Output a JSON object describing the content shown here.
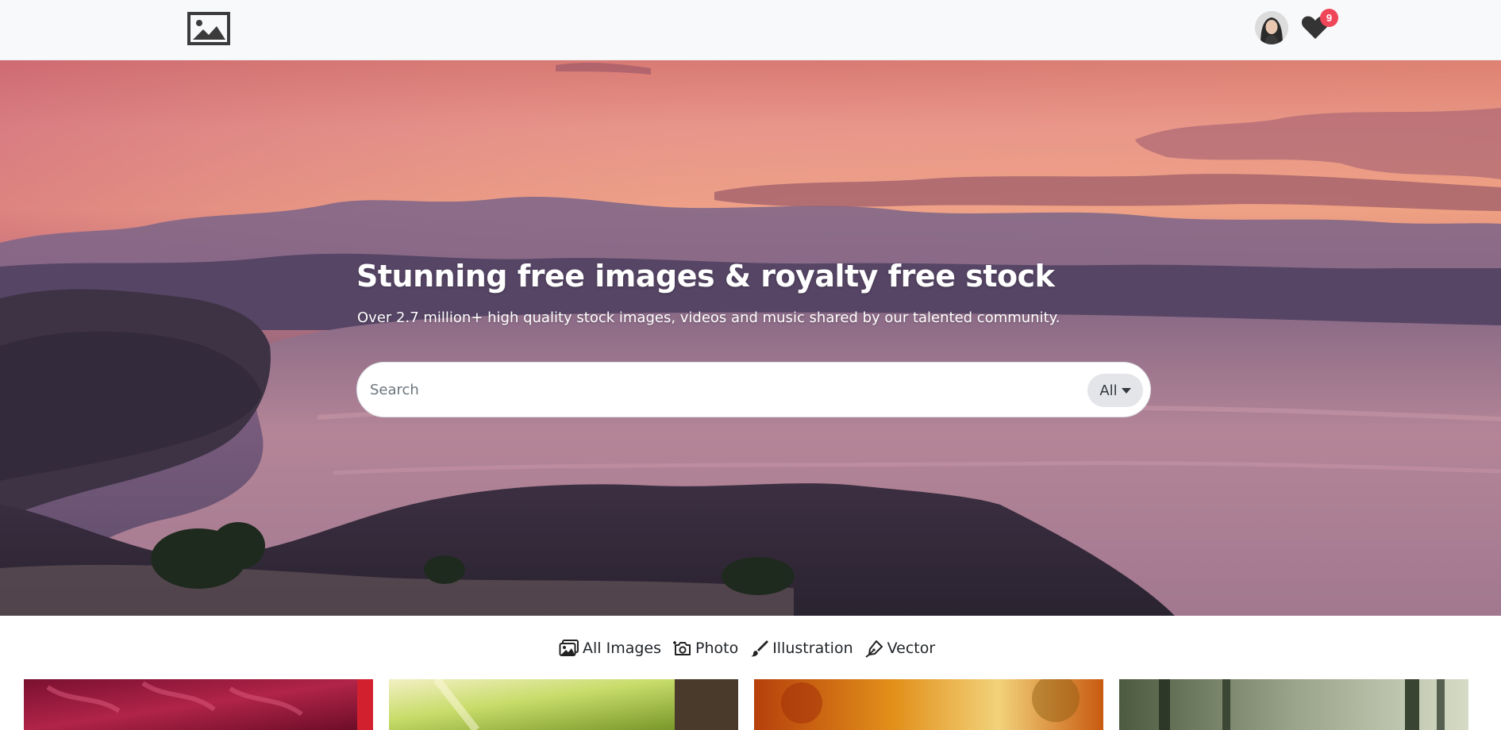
{
  "navbar": {
    "logo_icon": "image-logo-icon",
    "avatar_icon": "user-avatar",
    "favorites_icon": "heart-icon",
    "favorites_count": "9"
  },
  "hero": {
    "title": "Stunning free images & royalty free stock",
    "subtitle": "Over 2.7 million+ high quality stock images, videos and music shared by our talented community.",
    "search": {
      "placeholder": "Search",
      "value": "",
      "type_selected": "All"
    }
  },
  "filters": [
    {
      "label": "All Images",
      "icon": "images-icon"
    },
    {
      "label": "Photo",
      "icon": "camera-icon"
    },
    {
      "label": "Illustration",
      "icon": "brush-icon"
    },
    {
      "label": "Vector",
      "icon": "vector-pen-icon"
    }
  ],
  "colors": {
    "navbar_bg": "#f8f9fb",
    "badge": "#f0465a",
    "text": "#212529"
  }
}
